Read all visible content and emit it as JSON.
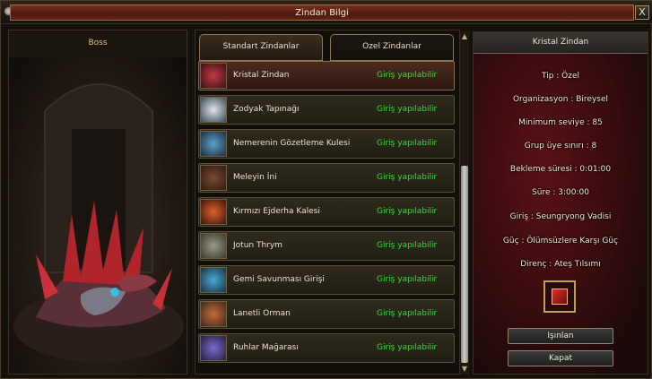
{
  "window": {
    "title": "Zindan Bilgi",
    "close_label": "X"
  },
  "boss": {
    "header": "Boss"
  },
  "tabs": [
    {
      "label": "Standart Zindanlar",
      "active": true
    },
    {
      "label": "Ozel Zindanlar",
      "active": false
    }
  ],
  "dungeons": [
    {
      "name": "Kristal Zindan",
      "status": "Giriş yapılabilir",
      "icon": "crystal-dragon-icon"
    },
    {
      "name": "Zodyak Tapınağı",
      "status": "Giriş yapılabilir",
      "icon": "zodiac-temple-icon"
    },
    {
      "name": "Nemerenin Gözetleme Kulesi",
      "status": "Giriş yapılabilir",
      "icon": "watch-tower-icon"
    },
    {
      "name": "Meleyin İni",
      "status": "Giriş yapılabilir",
      "icon": "lair-icon"
    },
    {
      "name": "Kırmızı Ejderha Kalesi",
      "status": "Giriş yapılabilir",
      "icon": "red-dragon-castle-icon"
    },
    {
      "name": "Jotun Thrym",
      "status": "Giriş yapılabilir",
      "icon": "jotun-icon"
    },
    {
      "name": "Gemi Savunması Girişi",
      "status": "Giriş yapılabilir",
      "icon": "ship-defense-icon"
    },
    {
      "name": "Lanetli Orman",
      "status": "Giriş yapılabilir",
      "icon": "cursed-forest-icon"
    },
    {
      "name": "Ruhlar Mağarası",
      "status": "Giriş yapılabilir",
      "icon": "spirit-cave-icon"
    }
  ],
  "info": {
    "title": "Kristal Zindan",
    "lines": [
      "Tip : Özel",
      "Organizasyon : Bireysel",
      "Minimum seviye : 85",
      "Grup üye sınırı : 8",
      "Bekleme süresi : 0:01:00",
      "Süre : 3:00:00",
      "Giriş : Seungryong Vadisi",
      "Güç : Ölümsüzlere Karşı Güç",
      "Direnç : Ateş Tılsımı"
    ],
    "item_icon": "fire-talisman-icon",
    "teleport_label": "Işınlan",
    "close_label": "Kapat"
  },
  "colors": {
    "status_green": "#27e22c",
    "boss_label": "#e4c267",
    "title_bar": "#5e2315"
  }
}
